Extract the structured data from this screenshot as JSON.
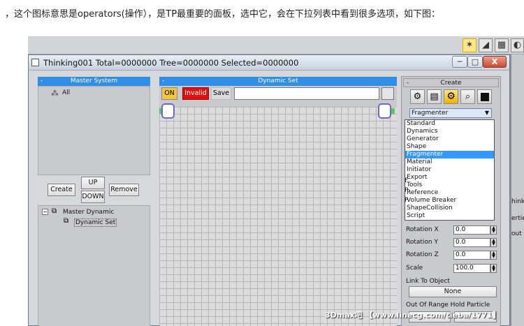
{
  "caption": "，这个图标意思是operators(操作），是TP最重要的面板，选中它，会在下拉列表中看到很多选项，如下图：",
  "window": {
    "title": "Thinking001  Total=0000000  Tree=0000000  Selected=0000000",
    "minimize": "─",
    "maximize": "□",
    "close": "X"
  },
  "master_system": {
    "header": "Master System",
    "collapse": "-",
    "root": "All"
  },
  "system_buttons": {
    "create": "Create",
    "up": "UP",
    "down": "DOWN",
    "remove": "Remove"
  },
  "dynamic_tree": {
    "master": "Master Dynamic",
    "child": "Dynamic Set"
  },
  "dynamic_set": {
    "header": "Dynamic Set",
    "collapse": "-",
    "on": "ON",
    "status": "Invalid",
    "save": "Save",
    "name_value": ""
  },
  "create_panel": {
    "header": "Create",
    "collapse": "-",
    "icons": [
      "tools-icon",
      "cube-grid-icon",
      "gear-icon",
      "magnifier-icon",
      "black-cube-icon"
    ],
    "selected": "Fragmenter",
    "options": [
      "Standard",
      "Dynamics",
      "Generator",
      "Shape",
      "Fragmenter",
      "Material",
      "Initiator",
      "Export",
      "Tools",
      "Reference",
      "Volume Breaker",
      "ShapeCollision",
      "Script"
    ],
    "highlighted_index": 4,
    "partial_labels": [
      "F",
      "P",
      "P"
    ],
    "fields": [
      {
        "label": "Rotation X",
        "value": "0.0"
      },
      {
        "label": "Rotation Y",
        "value": "0.0"
      },
      {
        "label": "Rotation Z",
        "value": "0.0"
      },
      {
        "label": "Scale",
        "value": "100.0"
      }
    ],
    "link_label": "Link To Object",
    "link_button": "None",
    "out_of_range": "Out Of Range Hold Particle"
  },
  "side_fragment": {
    "items": [
      "hink",
      "ertie",
      "out"
    ]
  },
  "watermark": "3Dmax吧  【www.linecg.com/tieba/1771】",
  "colors": {
    "header_blue": "#2f8fe6",
    "on_yellow": "#f2c53d",
    "invalid_red": "#e01010",
    "highlight": "#3399ff"
  }
}
